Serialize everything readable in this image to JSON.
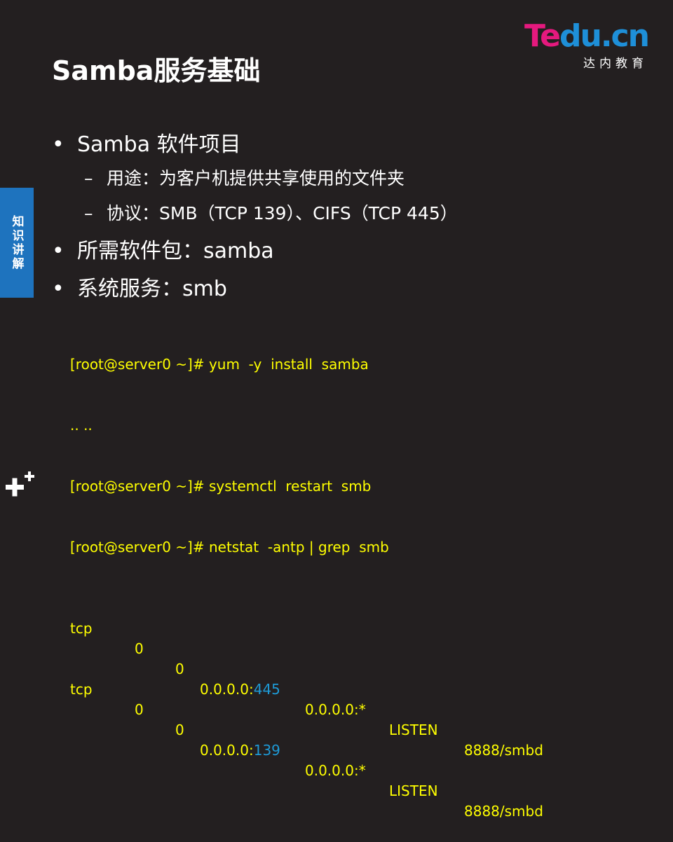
{
  "logo": {
    "text_part1": "Te",
    "text_part2": "du.cn",
    "subtitle": "达内教育"
  },
  "title": "Samba服务基础",
  "side_tab": "知识讲解",
  "bullets": [
    {
      "level": 1,
      "marker": "•",
      "text": "Samba 软件项目"
    },
    {
      "level": 2,
      "marker": "–",
      "text": "用途：为客户机提供共享使用的文件夹"
    },
    {
      "level": 2,
      "marker": "–",
      "text": "协议：SMB（TCP 139）、CIFS（TCP 445）"
    },
    {
      "level": 1,
      "marker": "•",
      "text": "所需软件包：samba"
    },
    {
      "level": 1,
      "marker": "•",
      "text": "系统服务：smb"
    }
  ],
  "terminal": {
    "lines": [
      "[root@server0 ~]# yum  -y  install  samba",
      ".. ..",
      "[root@server0 ~]# systemctl  restart  smb",
      "[root@server0 ~]# netstat  -antp | grep  smb"
    ],
    "rows": [
      {
        "proto": "tcp",
        "recvq": "0",
        "sendq": "0",
        "local_prefix": "0.0.0.0:",
        "local_port": "445",
        "foreign": "0.0.0.0:*",
        "state": "LISTEN",
        "program": "8888/smbd"
      },
      {
        "proto": "tcp",
        "recvq": "0",
        "sendq": "0",
        "local_prefix": "0.0.0.0:",
        "local_port": "139",
        "foreign": "0.0.0.0:*",
        "state": "LISTEN",
        "program": "8888/smbd"
      }
    ]
  },
  "colors": {
    "background": "#231f20",
    "terminal_text": "#ffff00",
    "port_highlight": "#1e9ad6",
    "side_tab": "#1e73be",
    "logo_pink": "#e5197e",
    "logo_blue": "#1e8fd8"
  },
  "icons": {
    "corner": "plus-plus-icon"
  }
}
